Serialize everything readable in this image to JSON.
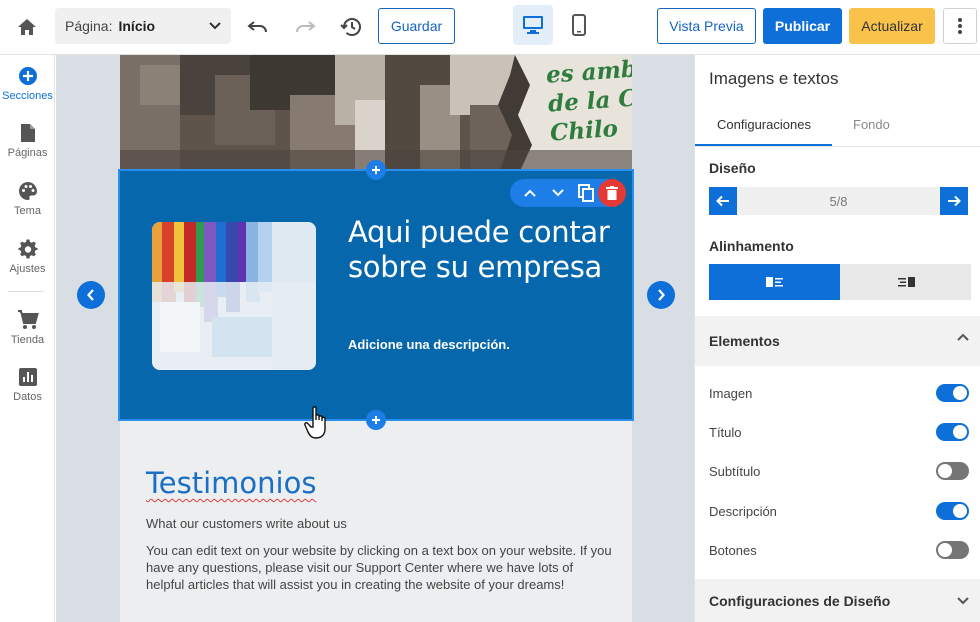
{
  "topbar": {
    "page_label": "Página:",
    "page_value": "Início",
    "save_label": "Guardar",
    "preview_label": "Vista Previa",
    "publish_label": "Publicar",
    "update_label": "Actualizar"
  },
  "sidebar": {
    "items": [
      {
        "label": "Secciones",
        "icon": "plus-circle-icon"
      },
      {
        "label": "Páginas",
        "icon": "page-icon"
      },
      {
        "label": "Tema",
        "icon": "palette-icon"
      },
      {
        "label": "Ajustes",
        "icon": "gear-icon"
      },
      {
        "label": "Tienda",
        "icon": "cart-icon"
      },
      {
        "label": "Datos",
        "icon": "chart-icon"
      }
    ]
  },
  "canvas": {
    "hero_sign_text": "es amba\nde la C\nChilo",
    "section_title": "Aqui puede contar sobre su empresa",
    "section_description": "Adicione una descripción.",
    "testimonials_title": "Testimonios",
    "testimonials_subtitle": "What our customers write about us",
    "testimonials_body": "You can edit text on your website by clicking on a text box on your website. If you have any questions, please visit our Support Center where we have lots of helpful articles that will assist you in creating the website of your dreams!"
  },
  "panel": {
    "title": "Imagens e textos",
    "tabs": [
      {
        "label": "Configuraciones",
        "active": true
      },
      {
        "label": "Fondo",
        "active": false
      }
    ],
    "design_label": "Diseño",
    "design_pager": "5/8",
    "alignment_label": "Alinhamento",
    "elements_label": "Elementos",
    "toggles": [
      {
        "label": "Imagen",
        "on": true
      },
      {
        "label": "Título",
        "on": true
      },
      {
        "label": "Subtítulo",
        "on": false
      },
      {
        "label": "Descripción",
        "on": true
      },
      {
        "label": "Botones",
        "on": false
      }
    ],
    "design_settings_label": "Configuraciones de Diseño"
  },
  "colors": {
    "primary": "#0d6fd7",
    "section_bg": "#0667ad",
    "warning": "#f9c24a",
    "delete": "#e53935"
  }
}
